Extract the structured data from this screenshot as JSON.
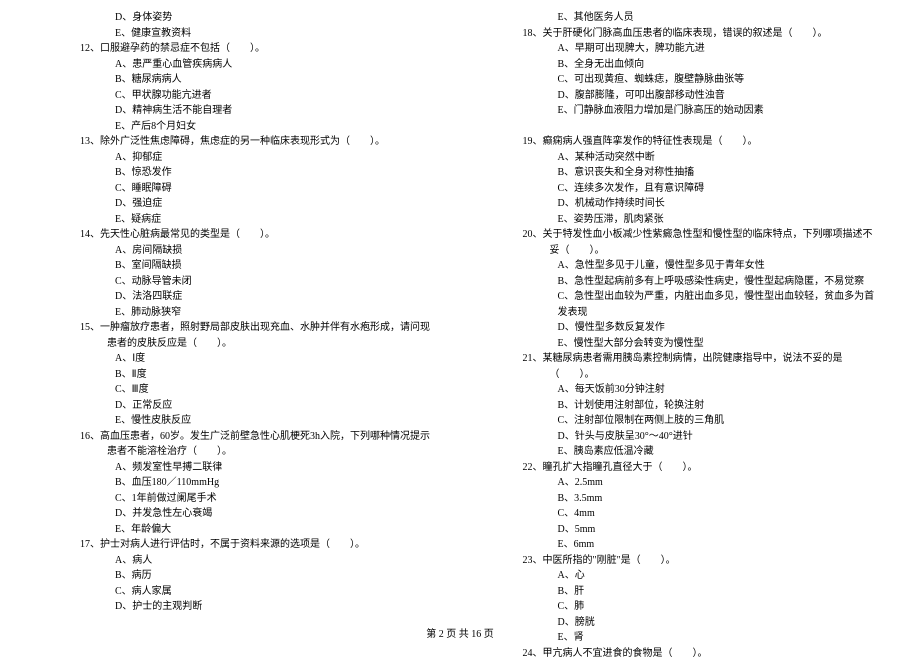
{
  "left_col": [
    {
      "type": "option",
      "text": "D、身体姿势"
    },
    {
      "type": "option",
      "text": "E、健康宣教资料"
    },
    {
      "type": "question",
      "text": "12、口服避孕药的禁忌症不包括（　　）。"
    },
    {
      "type": "option",
      "text": "A、患严重心血管疾病病人"
    },
    {
      "type": "option",
      "text": "B、糖尿病病人"
    },
    {
      "type": "option",
      "text": "C、甲状腺功能亢进者"
    },
    {
      "type": "option",
      "text": "D、精神病生活不能自理者"
    },
    {
      "type": "option",
      "text": "E、产后8个月妇女"
    },
    {
      "type": "question",
      "text": "13、除外广泛性焦虑障碍，焦虑症的另一种临床表现形式为（　　）。"
    },
    {
      "type": "option",
      "text": "A、抑郁症"
    },
    {
      "type": "option",
      "text": "B、惊恐发作"
    },
    {
      "type": "option",
      "text": "C、睡眠障碍"
    },
    {
      "type": "option",
      "text": "D、强迫症"
    },
    {
      "type": "option",
      "text": "E、疑病症"
    },
    {
      "type": "question",
      "text": "14、先天性心脏病最常见的类型是（　　）。"
    },
    {
      "type": "option",
      "text": "A、房间隔缺损"
    },
    {
      "type": "option",
      "text": "B、室间隔缺损"
    },
    {
      "type": "option",
      "text": "C、动脉导管未闭"
    },
    {
      "type": "option",
      "text": "D、法洛四联症"
    },
    {
      "type": "option",
      "text": "E、肺动脉狭窄"
    },
    {
      "type": "question",
      "text": "15、一肿瘤放疗患者，照射野局部皮肤出现充血、水肿并伴有水疱形成，请问现患者的皮肤反应是（　　）。"
    },
    {
      "type": "option",
      "text": "A、Ⅰ度"
    },
    {
      "type": "option",
      "text": "B、Ⅱ度"
    },
    {
      "type": "option",
      "text": "C、Ⅲ度"
    },
    {
      "type": "option",
      "text": "D、正常反应"
    },
    {
      "type": "option",
      "text": "E、慢性皮肤反应"
    },
    {
      "type": "question",
      "text": "16、高血压患者，60岁。发生广泛前壁急性心肌梗死3h入院，下列哪种情况提示患者不能溶栓治疗（　　）。"
    },
    {
      "type": "option",
      "text": "A、频发室性早搏二联律"
    },
    {
      "type": "option",
      "text": "B、血压180／110mmHg"
    },
    {
      "type": "option",
      "text": "C、1年前做过阑尾手术"
    },
    {
      "type": "option",
      "text": "D、并发急性左心衰竭"
    },
    {
      "type": "option",
      "text": "E、年龄偏大"
    },
    {
      "type": "question",
      "text": "17、护士对病人进行评估时，不属于资料来源的选项是（　　）。"
    },
    {
      "type": "option",
      "text": "A、病人"
    },
    {
      "type": "option",
      "text": "B、病历"
    },
    {
      "type": "option",
      "text": "C、病人家属"
    },
    {
      "type": "option",
      "text": "D、护士的主观判断"
    }
  ],
  "right_col": [
    {
      "type": "option",
      "text": "E、其他医务人员"
    },
    {
      "type": "question",
      "text": "18、关于肝硬化门脉高血压患者的临床表现，错误的叙述是（　　）。"
    },
    {
      "type": "option",
      "text": "A、早期可出现脾大，脾功能亢进"
    },
    {
      "type": "option",
      "text": "B、全身无出血倾向"
    },
    {
      "type": "option",
      "text": "C、可出现黄疸、蜘蛛痣，腹壁静脉曲张等"
    },
    {
      "type": "option",
      "text": "D、腹部膨隆，可叩出腹部移动性浊音"
    },
    {
      "type": "option",
      "text": "E、门静脉血液阻力增加是门脉高压的始动因素"
    },
    {
      "type": "blank",
      "text": ""
    },
    {
      "type": "question",
      "text": "19、癫痫病人强直阵挛发作的特征性表现是（　　）。"
    },
    {
      "type": "option",
      "text": "A、某种活动突然中断"
    },
    {
      "type": "option",
      "text": "B、意识丧失和全身对称性抽搐"
    },
    {
      "type": "option",
      "text": "C、连续多次发作，且有意识障碍"
    },
    {
      "type": "option",
      "text": "D、机械动作持续时间长"
    },
    {
      "type": "option",
      "text": "E、姿势压滞，肌肉紧张"
    },
    {
      "type": "question",
      "text": "20、关于特发性血小板减少性紫癜急性型和慢性型的临床特点，下列哪项描述不妥（　　）。"
    },
    {
      "type": "option",
      "text": "A、急性型多见于儿童，慢性型多见于青年女性"
    },
    {
      "type": "option",
      "text": "B、急性型起病前多有上呼吸感染性病史，慢性型起病隐匿，不易觉察"
    },
    {
      "type": "option",
      "text": "C、急性型出血较为严重，内脏出血多见，慢性型出血较轻，贫血多为首发表现"
    },
    {
      "type": "option",
      "text": "D、慢性型多数反复发作"
    },
    {
      "type": "option",
      "text": "E、慢性型大部分会转变为慢性型"
    },
    {
      "type": "question",
      "text": "21、某糖尿病患者需用胰岛素控制病情，出院健康指导中，说法不妥的是（　　）。"
    },
    {
      "type": "option",
      "text": "A、每天饭前30分钟注射"
    },
    {
      "type": "option",
      "text": "B、计划使用注射部位，轮换注射"
    },
    {
      "type": "option",
      "text": "C、注射部位限制在两侧上肢的三角肌"
    },
    {
      "type": "option",
      "text": "D、针头与皮肤呈30°～40°进针"
    },
    {
      "type": "option",
      "text": "E、胰岛素应低温冷藏"
    },
    {
      "type": "question",
      "text": "22、瞳孔扩大指瞳孔直径大于（　　）。"
    },
    {
      "type": "option",
      "text": "A、2.5mm"
    },
    {
      "type": "option",
      "text": "B、3.5mm"
    },
    {
      "type": "option",
      "text": "C、4mm"
    },
    {
      "type": "option",
      "text": "D、5mm"
    },
    {
      "type": "option",
      "text": "E、6mm"
    },
    {
      "type": "question",
      "text": "23、中医所指的\"刚脏\"是（　　）。"
    },
    {
      "type": "option",
      "text": "A、心"
    },
    {
      "type": "option",
      "text": "B、肝"
    },
    {
      "type": "option",
      "text": "C、肺"
    },
    {
      "type": "option",
      "text": "D、膀胱"
    },
    {
      "type": "option",
      "text": "E、肾"
    },
    {
      "type": "question",
      "text": "24、甲亢病人不宜进食的食物是（　　）。"
    }
  ],
  "footer": "第 2 页 共 16 页"
}
